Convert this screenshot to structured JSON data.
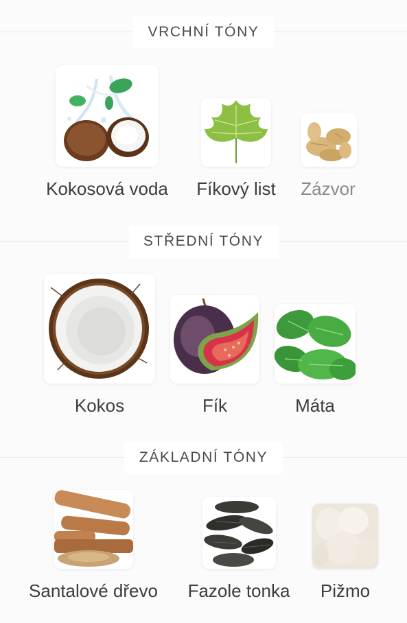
{
  "sections": [
    {
      "title": "VRCHNÍ TÓNY",
      "notes": [
        {
          "label": "Kokosová voda",
          "icon": "coconut-water-icon"
        },
        {
          "label": "Fíkový list",
          "icon": "fig-leaf-icon"
        },
        {
          "label": "Zázvor",
          "icon": "ginger-icon",
          "muted": true
        }
      ]
    },
    {
      "title": "STŘEDNÍ TÓNY",
      "notes": [
        {
          "label": "Kokos",
          "icon": "coconut-icon"
        },
        {
          "label": "Fík",
          "icon": "fig-icon"
        },
        {
          "label": "Máta",
          "icon": "mint-icon"
        }
      ]
    },
    {
      "title": "ZÁKLADNÍ TÓNY",
      "notes": [
        {
          "label": "Santalové dřevo",
          "icon": "sandalwood-icon"
        },
        {
          "label": "Fazole tonka",
          "icon": "tonka-bean-icon"
        },
        {
          "label": "Pižmo",
          "icon": "musk-icon"
        }
      ]
    }
  ]
}
